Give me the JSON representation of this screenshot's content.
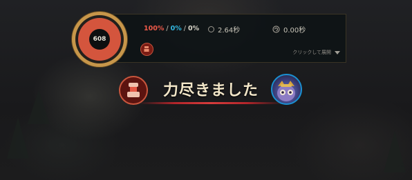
{
  "gauge": {
    "value": "608",
    "fill_fraction": 1.0,
    "ring_color": "#d4553d",
    "frame_color": "#c7964a"
  },
  "stats": {
    "pct_a": "100%",
    "pct_a_color": "#ef5a4a",
    "sep1": " / ",
    "pct_b": "0%",
    "pct_b_color": "#33b8e0",
    "sep2": " / ",
    "pct_c": "0%",
    "pct_c_color": "#d8d4c8",
    "time1": "2.64秒",
    "time2": "0.00秒"
  },
  "panel": {
    "expand_label": "クリックして展開"
  },
  "banner": {
    "title": "力尽きました"
  },
  "icons": {
    "damage_type": "red-chess-piece-icon",
    "mini_badge": "red-champion-badge-icon",
    "time1": "clock-icon",
    "time2": "spiral-timer-icon",
    "expand": "triangle-down-icon",
    "portrait": "champion-portrait-icon"
  }
}
